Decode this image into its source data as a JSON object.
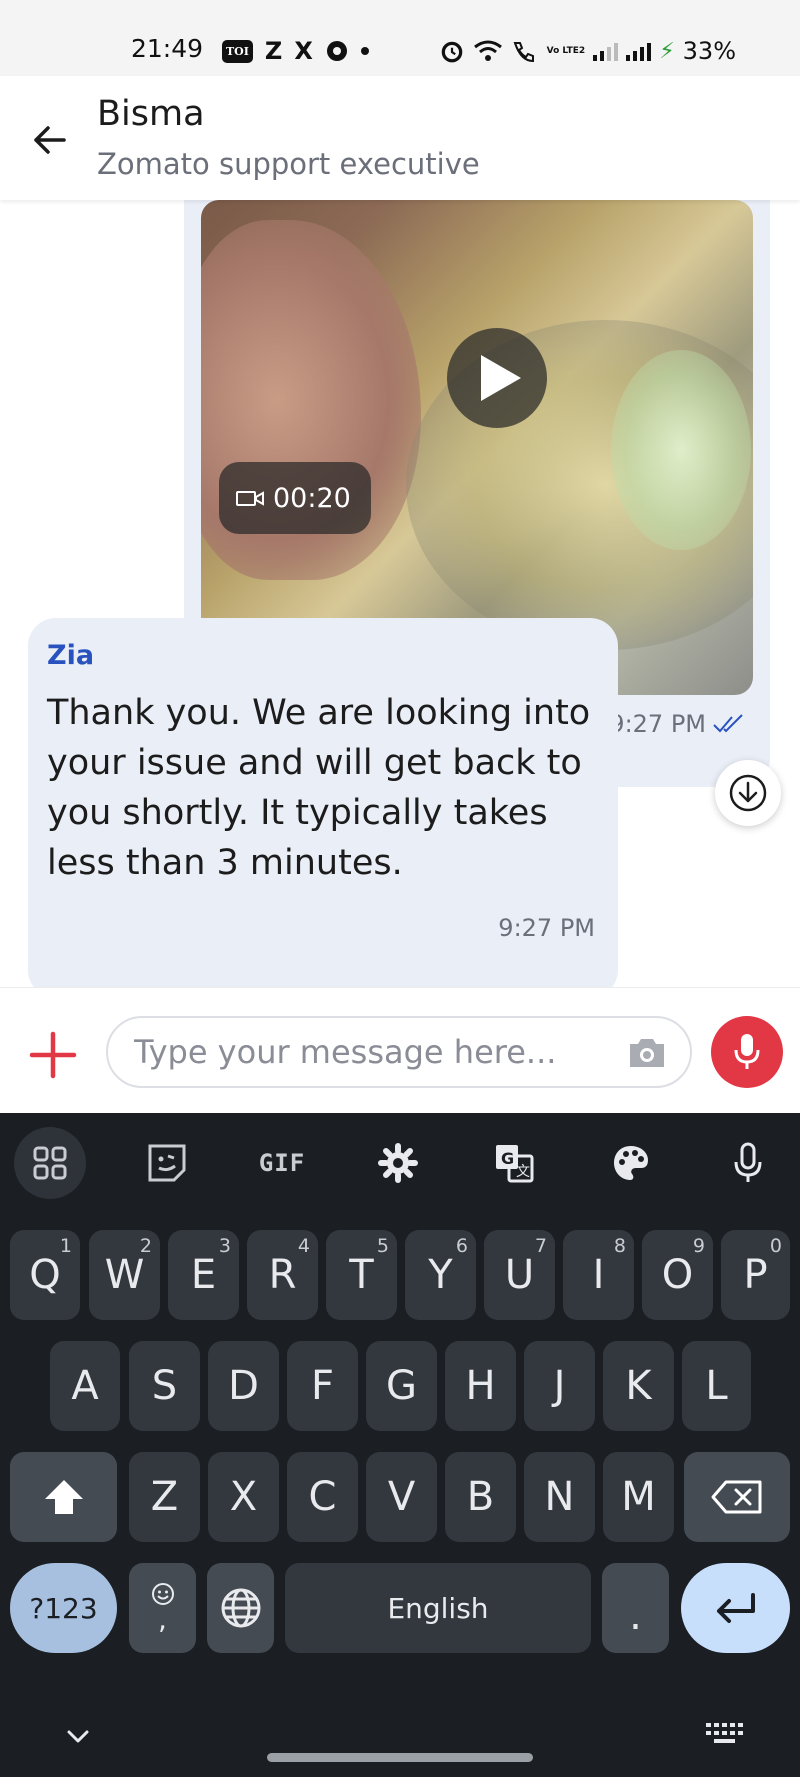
{
  "status_bar": {
    "time": "21:49",
    "app_badge": "TOI",
    "icon_z": "Z",
    "icon_x": "X",
    "volte": "Vo LTE2",
    "battery": "33%"
  },
  "header": {
    "name": "Bisma",
    "subtitle": "Zomato support executive"
  },
  "messages": {
    "outgoing_video": {
      "duration": "00:20",
      "time": "9:27 PM"
    },
    "incoming": {
      "sender": "Zia",
      "text": "Thank you. We are looking into your issue and will get back to you shortly. It typically takes less than 3 minutes.",
      "time": "9:27 PM"
    }
  },
  "composer": {
    "placeholder": "Type your message here..."
  },
  "keyboard": {
    "toolbar": [
      "apps-icon",
      "sticker-icon",
      "gif-icon",
      "settings-icon",
      "translate-icon",
      "palette-icon",
      "mic-icon"
    ],
    "gif_label": "GIF",
    "row1": [
      "Q",
      "W",
      "E",
      "R",
      "T",
      "Y",
      "U",
      "I",
      "O",
      "P"
    ],
    "row1_hints": [
      "1",
      "2",
      "3",
      "4",
      "5",
      "6",
      "7",
      "8",
      "9",
      "0"
    ],
    "row2": [
      "A",
      "S",
      "D",
      "F",
      "G",
      "H",
      "J",
      "K",
      "L"
    ],
    "row3": [
      "Z",
      "X",
      "C",
      "V",
      "B",
      "N",
      "M"
    ],
    "symbols_label": "?123",
    "comma_label": ",",
    "space_label": "English",
    "period_label": "."
  },
  "colors": {
    "brand_red": "#e23744",
    "bubble": "#eaeef7",
    "sender_blue": "#2a52be",
    "keyboard_bg": "#1b1f24",
    "key_bg": "#33383f"
  }
}
